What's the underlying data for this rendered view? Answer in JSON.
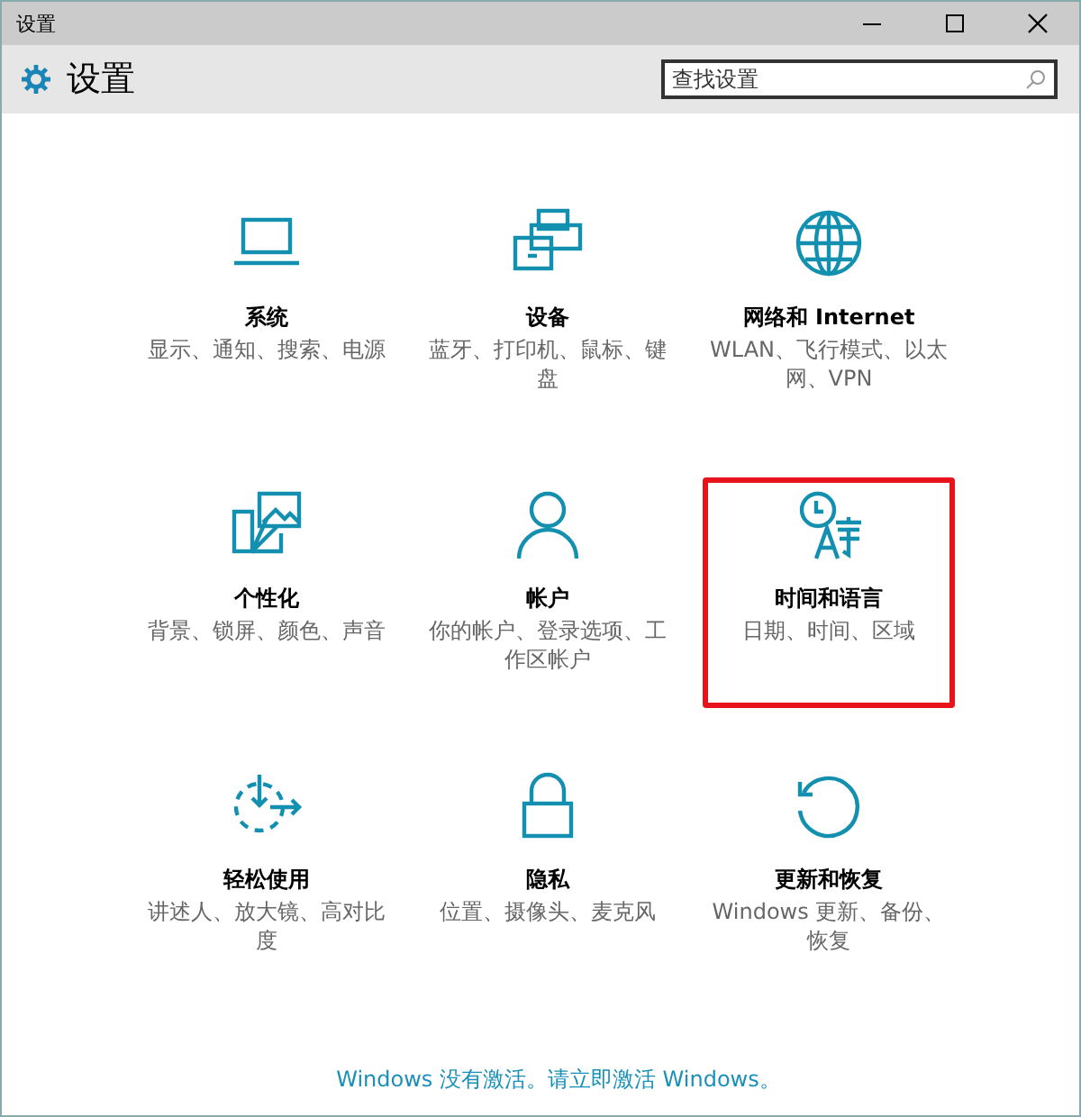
{
  "window": {
    "title": "设置"
  },
  "header": {
    "title": "设置",
    "search": {
      "placeholder": "查找设置"
    }
  },
  "tiles": [
    {
      "title": "系统",
      "description": "显示、通知、搜索、电源",
      "highlighted": false
    },
    {
      "title": "设备",
      "description": "蓝牙、打印机、鼠标、键盘",
      "highlighted": false
    },
    {
      "title": "网络和 Internet",
      "description": "WLAN、飞行模式、以太网、VPN",
      "highlighted": false
    },
    {
      "title": "个性化",
      "description": "背景、锁屏、颜色、声音",
      "highlighted": false
    },
    {
      "title": "帐户",
      "description": "你的帐户、登录选项、工作区帐户",
      "highlighted": false
    },
    {
      "title": "时间和语言",
      "description": "日期、时间、区域",
      "highlighted": true
    },
    {
      "title": "轻松使用",
      "description": "讲述人、放大镜、高对比度",
      "highlighted": false
    },
    {
      "title": "隐私",
      "description": "位置、摄像头、麦克风",
      "highlighted": false
    },
    {
      "title": "更新和恢复",
      "description": "Windows 更新、备份、恢复",
      "highlighted": false
    }
  ],
  "activation_link": "Windows 没有激活。请立即激活 Windows。"
}
